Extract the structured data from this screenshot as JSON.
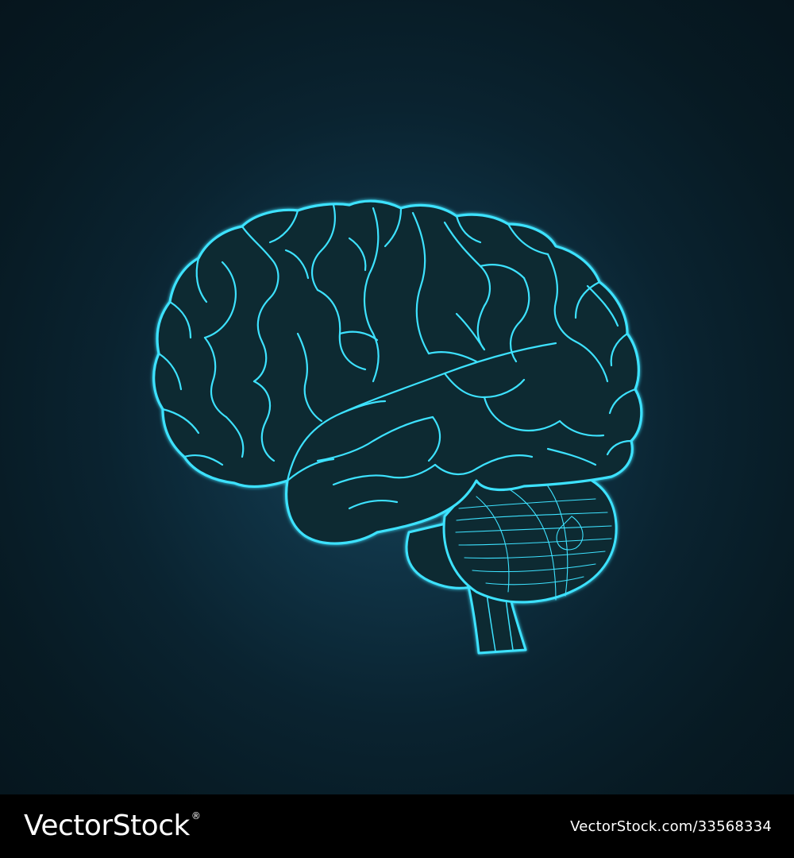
{
  "image": {
    "subject": "brain-illustration",
    "colors": {
      "background_center": "#17445a",
      "background_edge": "#06151d",
      "brain_fill": "#0d2a31",
      "outline": "#3ee2ff",
      "footer_background": "#000000",
      "footer_text": "#ffffff"
    }
  },
  "footer": {
    "brand": "VectorStock",
    "registered_mark": "®",
    "url": "VectorStock.com/33568334"
  }
}
